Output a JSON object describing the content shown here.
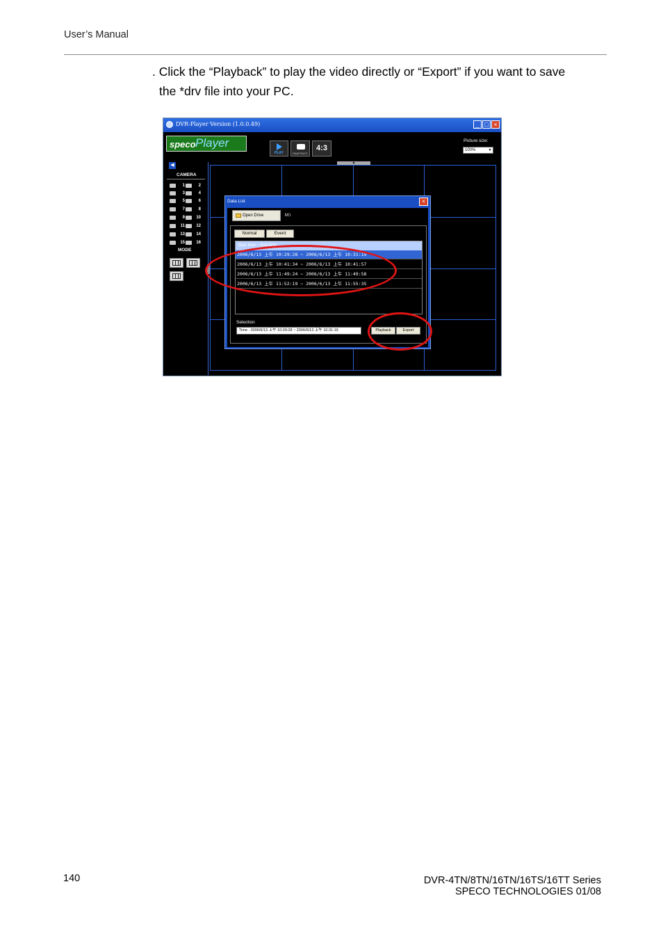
{
  "page": {
    "header": "User’s Manual",
    "instruction_line1": ". Click the “Playback” to play the video directly or “Export” if you want to save",
    "instruction_line2": "the *drv file into your PC.",
    "page_number": "140",
    "footer_line1": "DVR-4TN/8TN/16TN/16TS/16TT Series",
    "footer_line2": "SPECO TECHNOLOGIES 01/08"
  },
  "app": {
    "title": "DVR-Player Version (1.0.0.49)",
    "logo_part1": "speco",
    "logo_part2": "Player",
    "play_label": "PLAY",
    "snapshot_label": "SNAPSHOT",
    "ratio_label": "4:3",
    "picture_size_label": "Picture size:",
    "picture_size_value": "100%",
    "camera_title": "CAMERA",
    "mode_title": "MODE",
    "cameras": [
      "1",
      "2",
      "3",
      "4",
      "5",
      "6",
      "7",
      "8",
      "9",
      "10",
      "11",
      "12",
      "13",
      "14",
      "15",
      "16"
    ]
  },
  "dialog": {
    "title": "Data List",
    "open_drive": "Open Drive",
    "path": "M:\\",
    "tab_normal": "Normal",
    "tab_event": "Event",
    "list_header": "Start time ~ End time",
    "rows": [
      "2006/6/13 上午 10:29:28 ~ 2006/6/13 上午 10:31:19",
      "2006/6/13 上午 10:41:34 ~ 2006/6/13 上午 10:41:57",
      "2006/6/13 上午 11:49:24 ~ 2006/6/13 上午 11:49:58",
      "2006/6/13 上午 11:52:19 ~ 2006/6/13 上午 11:55:35"
    ],
    "selection_label": "Selection",
    "selection_value": "Time : 2006/6/13 上午 10:29:28 ~ 2006/6/13 上午 10:31:19",
    "playback": "Playback",
    "export": "Export"
  },
  "colors": {
    "accent": "#1a4fc4",
    "highlight_ring": "#e01414",
    "grid_line": "#2a5fd8"
  }
}
